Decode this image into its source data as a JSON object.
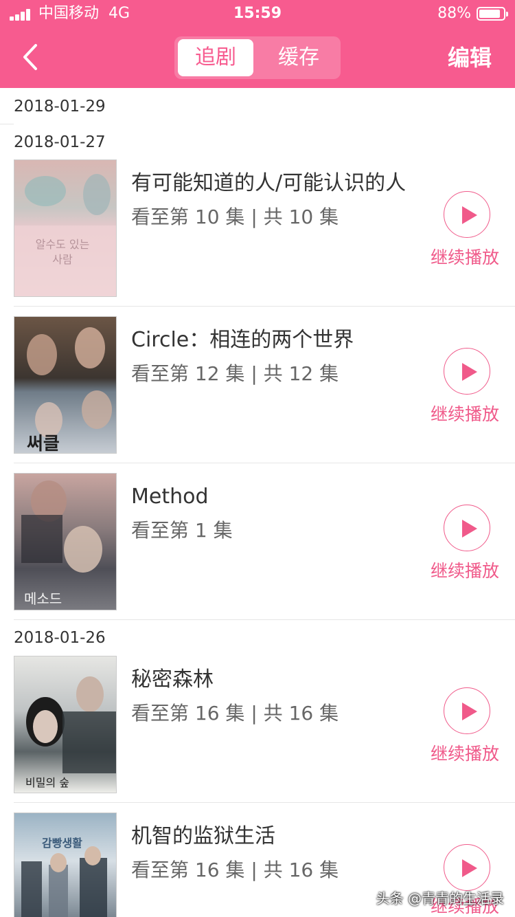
{
  "status_bar": {
    "carrier": "中国移动",
    "network": "4G",
    "time": "15:59",
    "battery": "88%",
    "battery_level": 0.88
  },
  "nav": {
    "tabs": [
      {
        "label": "追剧",
        "selected": true
      },
      {
        "label": "缓存",
        "selected": false
      }
    ],
    "edit_label": "编辑"
  },
  "colors": {
    "accent": "#f75b8f",
    "segment_bg": "#f87ca5",
    "play": "#f05a8a"
  },
  "dates": [
    "2018-01-29",
    "2018-01-27",
    "2018-01-26"
  ],
  "items": [
    {
      "title": "有可能知道的人/可能认识的人",
      "progress": "看至第 10 集 | 共 10 集",
      "action": "继续播放",
      "poster_text": "알수도 있는 사람"
    },
    {
      "title": "Circle：相连的两个世界",
      "progress": "看至第 12 集 | 共 12 集",
      "action": "继续播放",
      "poster_text": "써클"
    },
    {
      "title": "Method",
      "progress": "看至第 1 集",
      "action": "继续播放",
      "poster_text": "메소드"
    },
    {
      "title": "秘密森林",
      "progress": "看至第 16 集 | 共 16 集",
      "action": "继续播放",
      "poster_text": "비밀의 숲"
    },
    {
      "title": "机智的监狱生活",
      "progress": "看至第 16 集 | 共 16 集",
      "action": "继续播放",
      "poster_text": "감빵생활"
    }
  ],
  "watermark": "头条 @青青的生活录"
}
